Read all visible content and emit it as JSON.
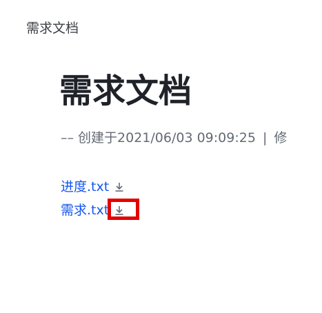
{
  "breadcrumb": {
    "label": "需求文档"
  },
  "document": {
    "title": "需求文档",
    "meta": {
      "prefix": "–– 创建于",
      "created": "2021/06/03 09:09:25",
      "separator": "|",
      "trailing": "修"
    },
    "files": [
      {
        "name": "进度.txt",
        "icon": "download-icon"
      },
      {
        "name": "需求.txt",
        "icon": "download-icon"
      }
    ]
  },
  "colors": {
    "link": "#1456f0",
    "highlight": "#e50000",
    "meta_text": "#646a73",
    "title_text": "#1f2329"
  }
}
